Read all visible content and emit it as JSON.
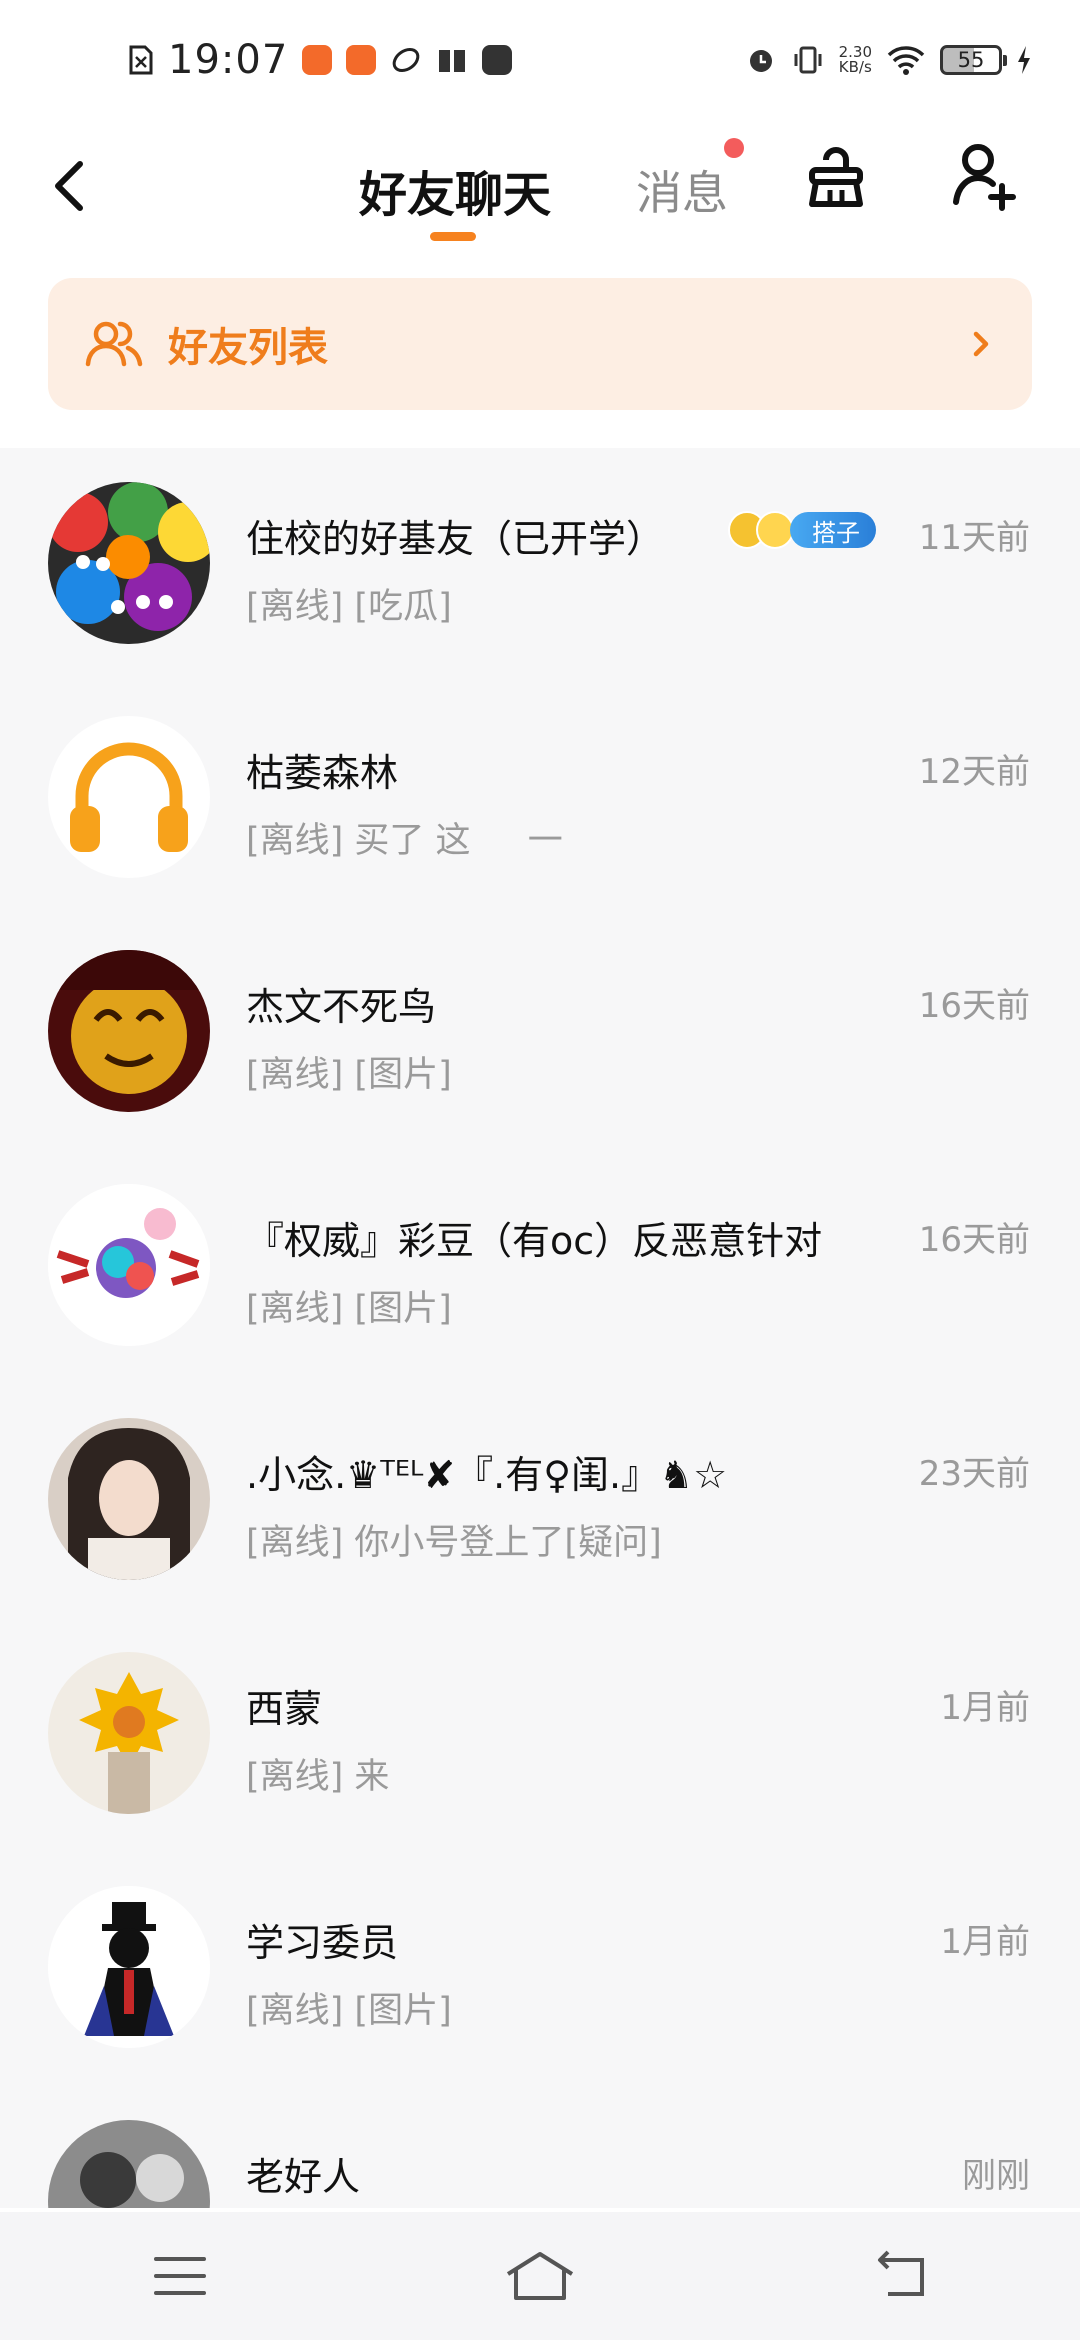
{
  "status_bar": {
    "time": "19:07",
    "net_speed_value": "2.30",
    "net_speed_unit": "KB/s",
    "battery": "55"
  },
  "header": {
    "tab_friends": "好友聊天",
    "tab_messages": "消息"
  },
  "friend_banner": {
    "label": "好友列表"
  },
  "chats": [
    {
      "name": "住校的好基友（已开学）",
      "tag": "搭子",
      "preview": "[离线] [吃瓜]",
      "time": "11天前"
    },
    {
      "name": "枯萎森林",
      "preview": "[离线] 买了 这 　 一",
      "time": "12天前"
    },
    {
      "name": "杰文不死鸟",
      "preview": "[离线] [图片]",
      "time": "16天前"
    },
    {
      "name": "『权威』彩豆（有oc）反恶意针对",
      "preview": "[离线] [图片]",
      "time": "16天前"
    },
    {
      "name": ".小念.♛ᵀᴱᴸ✘『.有♀闺.』♞☆",
      "preview": "[离线] 你小号登上了[疑问]",
      "time": "23天前"
    },
    {
      "name": "西蒙",
      "preview": "[离线] 来",
      "time": "1月前"
    },
    {
      "name": "学习委员",
      "preview": "[离线] [图片]",
      "time": "1月前"
    },
    {
      "name": "老好人",
      "preview": "",
      "time": "刚刚"
    }
  ],
  "colors": {
    "accent": "#f6821f",
    "banner_bg": "#fdeee3",
    "unread_dot": "#f35c5c"
  }
}
